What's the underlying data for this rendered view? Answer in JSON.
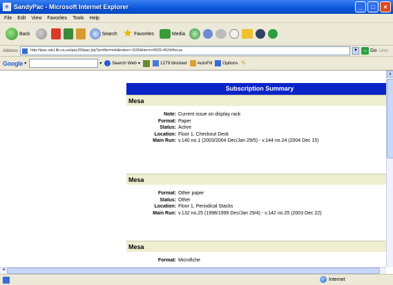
{
  "window": {
    "title": "SandyPac - Microsoft Internet Explorer"
  },
  "menu": [
    "File",
    "Edit",
    "View",
    "Favorites",
    "Tools",
    "Help"
  ],
  "toolbar": {
    "back": "Back",
    "search": "Search",
    "favorites": "Favorites",
    "media": "Media"
  },
  "address": {
    "label": "Address",
    "url": "http://ipac.sdcl.lib.ca.us/ipac20/ipac.jsp?profile=mdr&index=.ISSN&term=0029-4624#focus",
    "go": "Go",
    "links": "Links"
  },
  "googlebar": {
    "logo": "Google",
    "search_web": "Search Web",
    "blocked": "1279 blocked",
    "autofill": "AutoFill",
    "options": "Options"
  },
  "page": {
    "banner": "Subscription Summary",
    "records": [
      {
        "title": "Mesa",
        "fields": [
          {
            "label": "Note:",
            "value": "Current issue on display rack"
          },
          {
            "label": "Format:",
            "value": "Paper"
          },
          {
            "label": "Status:",
            "value": "Active"
          },
          {
            "label": "Location:",
            "value": "Floor 1, Checkout Desk"
          },
          {
            "label": "Main Run:",
            "value": "v.140 no.1 (2003/2004 Dec/Jan 29/5) - v.144 no.24 (2004 Dec 15)"
          }
        ]
      },
      {
        "title": "Mesa",
        "fields": [
          {
            "label": "Format:",
            "value": "Other paper"
          },
          {
            "label": "Status:",
            "value": "Other"
          },
          {
            "label": "Location:",
            "value": "Floor 1, Periodical Stacks"
          },
          {
            "label": "Main Run:",
            "value": "v.132 no.25 (1998/1999 Dec/Jan 29/4) - v.142 no.25 (2003 Dec 22)"
          }
        ]
      },
      {
        "title": "Mesa",
        "fields": [
          {
            "label": "Format:",
            "value": "Microfiche"
          }
        ]
      }
    ]
  },
  "status": {
    "zone": "Internet"
  }
}
